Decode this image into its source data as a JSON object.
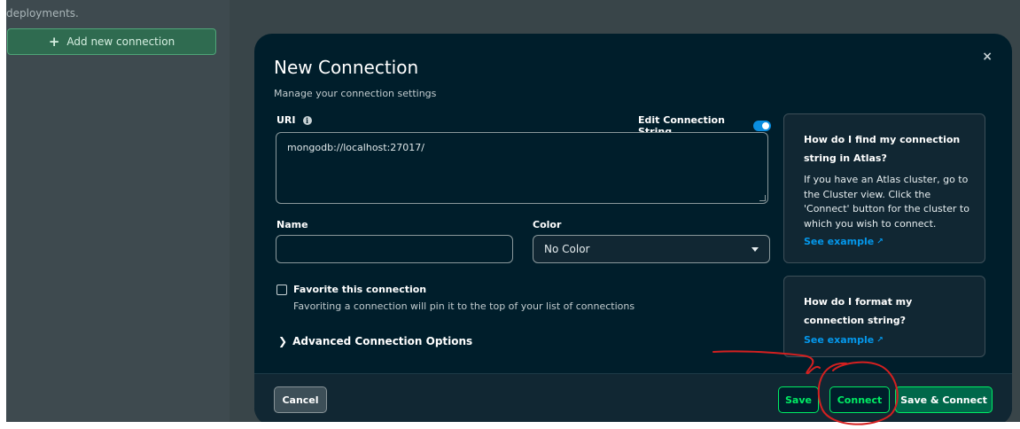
{
  "sidebar": {
    "top_text": "deployments.",
    "add_button_label": "Add new connection"
  },
  "dialog": {
    "title": "New Connection",
    "subtitle": "Manage your connection settings",
    "close_symbol": "×",
    "uri": {
      "label": "URI",
      "info_symbol": "i",
      "value": "mongodb://localhost:27017/"
    },
    "edit_connection_string": {
      "label": "Edit Connection String",
      "enabled": true
    },
    "name": {
      "label": "Name",
      "value": ""
    },
    "color": {
      "label": "Color",
      "selected": "No Color"
    },
    "favorite": {
      "title": "Favorite this connection",
      "description": "Favoriting a connection will pin it to the top of your list of connections",
      "checked": false
    },
    "advanced_label": "Advanced Connection Options",
    "help_cards": [
      {
        "title": "How do I find my connection string in Atlas?",
        "body": "If you have an Atlas cluster, go to the Cluster view. Click the 'Connect' button for the cluster to which you wish to connect.",
        "link": "See example"
      },
      {
        "title": "How do I format my connection string?",
        "link": "See example"
      }
    ],
    "footer": {
      "cancel": "Cancel",
      "save": "Save",
      "connect": "Connect",
      "save_connect": "Save & Connect"
    }
  },
  "colors": {
    "dialog_bg": "#001e2b",
    "footer_bg": "#112733",
    "accent_green": "#00ed64",
    "link_blue": "#0498ec",
    "annotation_red": "#d42020"
  },
  "icons": [
    "plus-icon",
    "close-icon",
    "info-icon",
    "chevron-right-icon",
    "caret-down-icon",
    "external-link-icon"
  ]
}
